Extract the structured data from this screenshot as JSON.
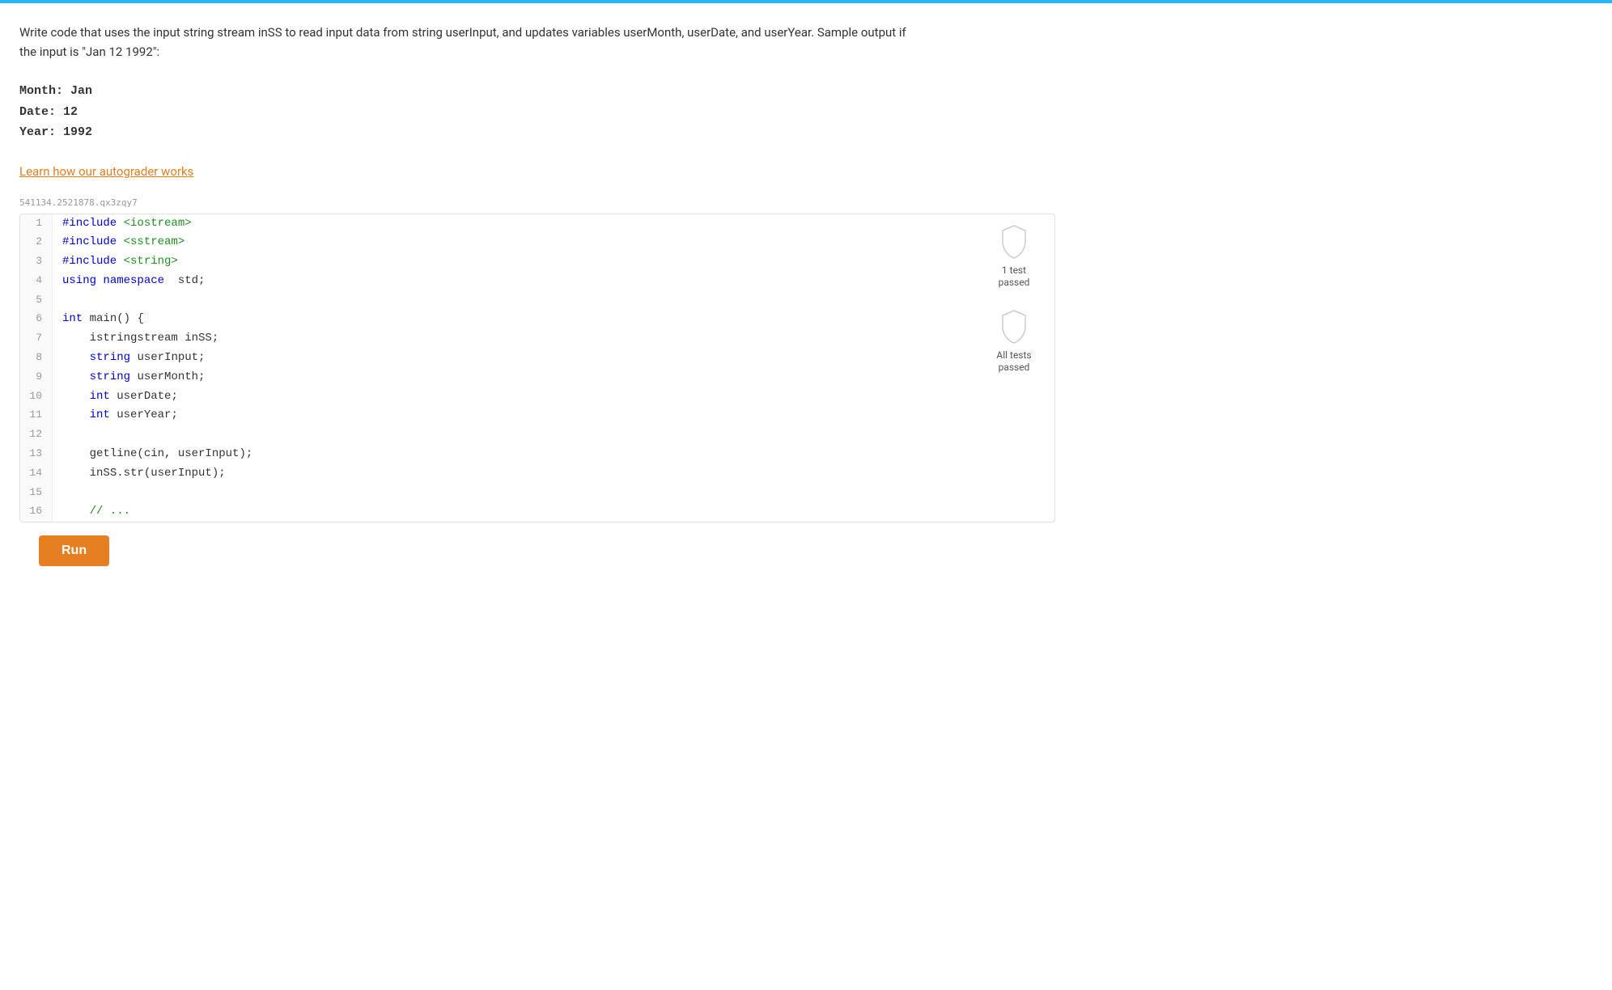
{
  "top_bar": {
    "color": "#29b6f6"
  },
  "description": {
    "text": "Write code that uses the input string stream inSS to read input data from string userInput, and updates variables userMonth, userDate, and userYear. Sample output if the input is \"Jan 12 1992\":"
  },
  "sample_output": {
    "lines": [
      "Month: Jan",
      "Date: 12",
      "Year: 1992"
    ]
  },
  "autograder_link": {
    "label": "Learn how our autograder works"
  },
  "code_section_id": "541134.2521878.qx3zqy7",
  "code": {
    "lines": [
      {
        "num": 1,
        "content": "#include <iostream>"
      },
      {
        "num": 2,
        "content": "#include <sstream>"
      },
      {
        "num": 3,
        "content": "#include <string>"
      },
      {
        "num": 4,
        "content": "using namespace std;"
      },
      {
        "num": 5,
        "content": ""
      },
      {
        "num": 6,
        "content": "int main() {"
      },
      {
        "num": 7,
        "content": "   istringstream inSS;"
      },
      {
        "num": 8,
        "content": "   string userInput;"
      },
      {
        "num": 9,
        "content": "   string userMonth;"
      },
      {
        "num": 10,
        "content": "   int userDate;"
      },
      {
        "num": 11,
        "content": "   int userYear;"
      },
      {
        "num": 12,
        "content": ""
      },
      {
        "num": 13,
        "content": "   getline(cin, userInput);"
      },
      {
        "num": 14,
        "content": "   inSS.str(userInput);"
      },
      {
        "num": 15,
        "content": ""
      },
      {
        "num": 16,
        "content": "   // ..."
      }
    ]
  },
  "badges": [
    {
      "id": "badge-1-test",
      "label": "1 test\npassed"
    },
    {
      "id": "badge-all-tests",
      "label": "All tests\npassed"
    }
  ],
  "run_button": {
    "label": "Run"
  }
}
